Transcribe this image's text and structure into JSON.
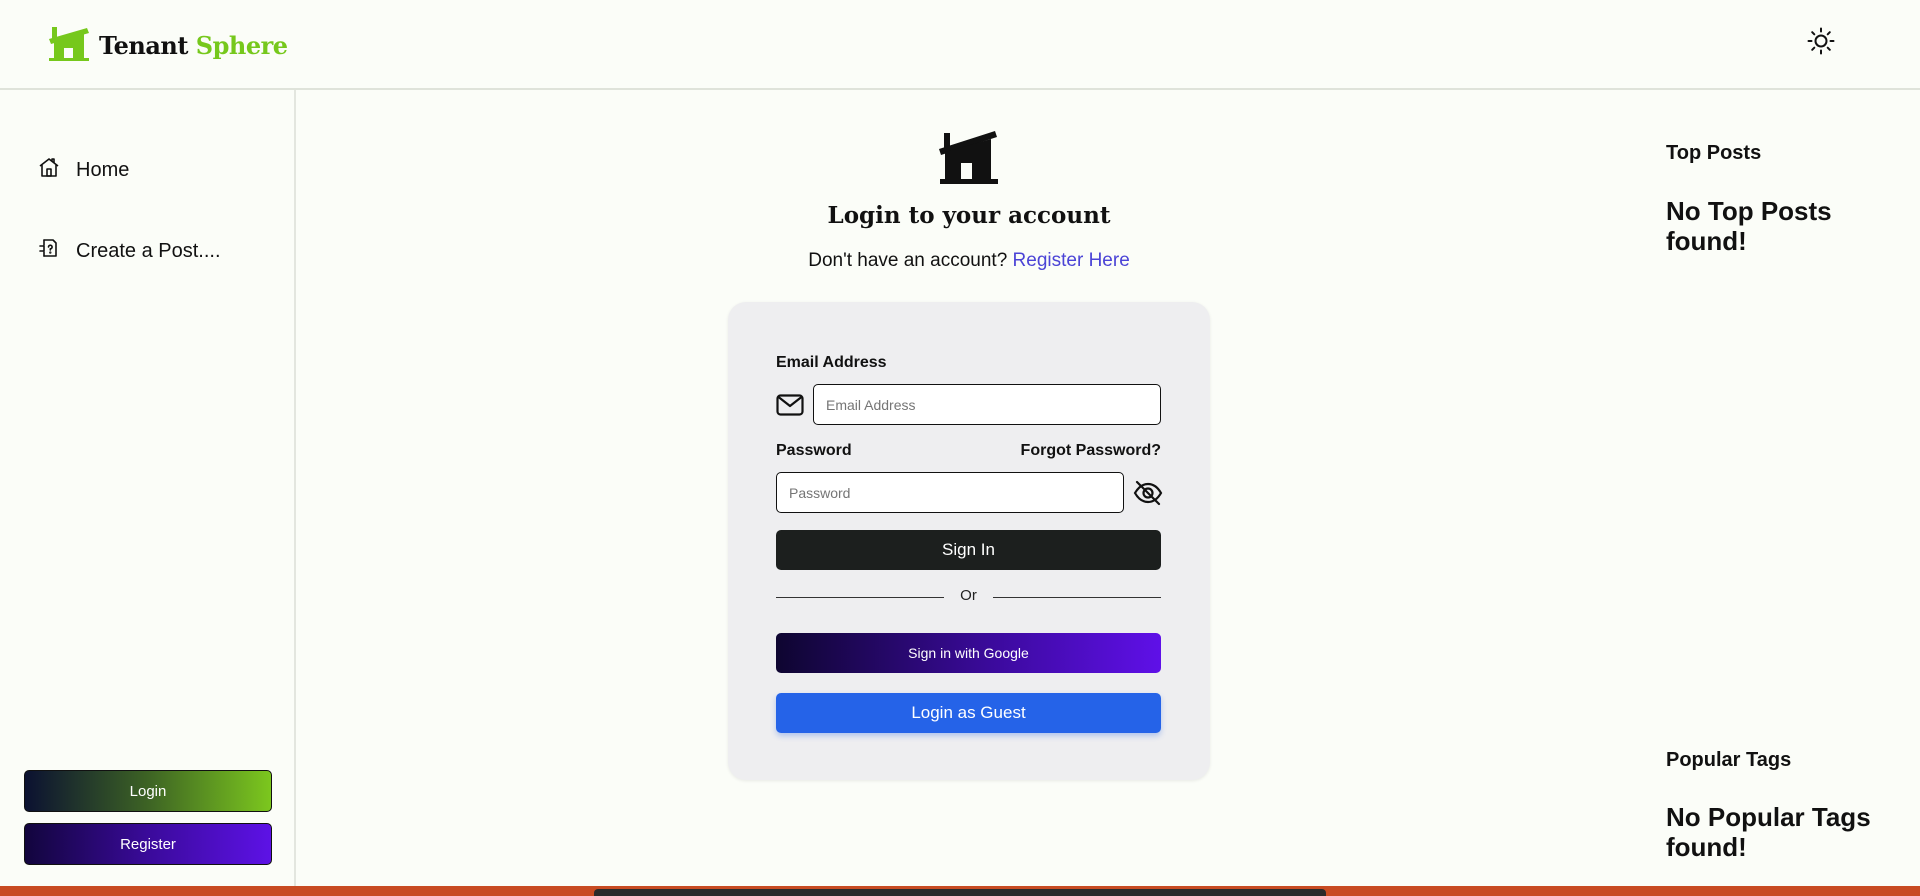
{
  "header": {
    "brand_part1": "Tenant",
    "brand_part2": "Sphere",
    "logo_icon": "house-icon",
    "theme_icon": "sun-icon"
  },
  "sidebar": {
    "items": [
      {
        "label": "Home",
        "icon": "home-icon"
      },
      {
        "label": "Create a Post....",
        "icon": "create-post-icon"
      }
    ],
    "login_label": "Login",
    "register_label": "Register"
  },
  "main": {
    "title": "Login to your account",
    "register_prompt": "Don't have an account?",
    "register_link": "Register Here",
    "form": {
      "email_label": "Email Address",
      "email_placeholder": "Email Address",
      "email_value": "",
      "password_label": "Password",
      "forgot_label": "Forgot Password?",
      "password_placeholder": "Password",
      "password_value": "",
      "signin_label": "Sign In",
      "or_label": "Or",
      "google_label": "Sign in with Google",
      "guest_label": "Login as Guest"
    }
  },
  "rightbar": {
    "top_posts_title": "Top Posts",
    "top_posts_empty": "No Top Posts found!",
    "popular_tags_title": "Popular Tags",
    "popular_tags_empty": "No Popular Tags found!"
  },
  "colors": {
    "brand_green": "#76c81c",
    "link_purple": "#4b44d6",
    "guest_blue": "#2563e8",
    "signin_dark": "#1c1f1e",
    "page_bg": "#fbfdf8"
  }
}
